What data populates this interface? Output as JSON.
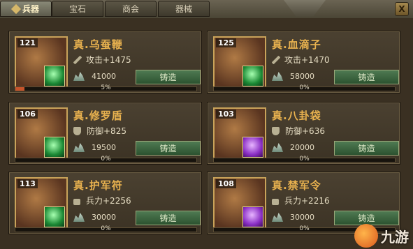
{
  "tabs": [
    {
      "label": "兵器",
      "active": true
    },
    {
      "label": "宝石",
      "active": false
    },
    {
      "label": "商会",
      "active": false
    },
    {
      "label": "器械",
      "active": false
    }
  ],
  "close_label": "X",
  "forge_label": "铸造",
  "items": [
    {
      "level": "121",
      "name": "真.乌蚕鞭",
      "stat": "攻击+1475",
      "stat_icon": "sword-icon",
      "cost": "41000",
      "progress_pct": 5,
      "progress_label": "5%",
      "gem_color": "green"
    },
    {
      "level": "125",
      "name": "真.血滴子",
      "stat": "攻击+1470",
      "stat_icon": "sword-icon",
      "cost": "58000",
      "progress_pct": 0,
      "progress_label": "0%",
      "gem_color": "green"
    },
    {
      "level": "106",
      "name": "真.修罗盾",
      "stat": "防御+825",
      "stat_icon": "shield-icon",
      "cost": "19500",
      "progress_pct": 0,
      "progress_label": "0%",
      "gem_color": "green"
    },
    {
      "level": "103",
      "name": "真.八卦袋",
      "stat": "防御+636",
      "stat_icon": "shield-icon",
      "cost": "20000",
      "progress_pct": 0,
      "progress_label": "0%",
      "gem_color": "purple"
    },
    {
      "level": "113",
      "name": "真.护军符",
      "stat": "兵力+2256",
      "stat_icon": "troops-icon",
      "cost": "30000",
      "progress_pct": 0,
      "progress_label": "0%",
      "gem_color": "green"
    },
    {
      "level": "108",
      "name": "真.禁军令",
      "stat": "兵力+2216",
      "stat_icon": "troops-icon",
      "cost": "30000",
      "progress_pct": 0,
      "progress_label": "0%",
      "gem_color": "purple"
    }
  ],
  "watermark": "九游"
}
